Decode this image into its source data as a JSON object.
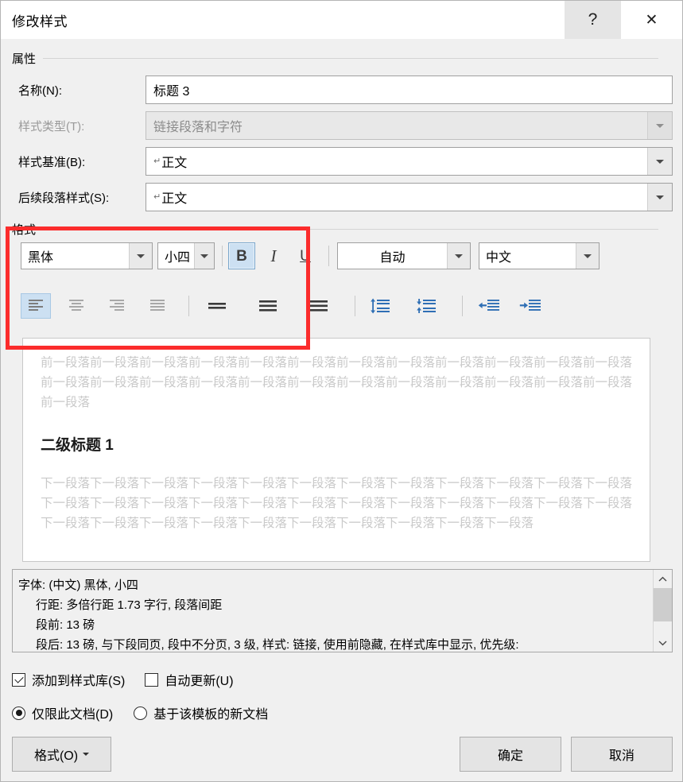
{
  "window": {
    "title": "修改样式",
    "help_label": "?",
    "close_label": "✕"
  },
  "properties": {
    "group_label": "属性",
    "fields": [
      {
        "label": "名称(N):",
        "label_plain": "名称(N):",
        "value": "标题 3",
        "type": "text",
        "disabled": false,
        "pilcrow": false
      },
      {
        "label": "样式类型(T):",
        "label_plain": "样式类型(T):",
        "value": "链接段落和字符",
        "type": "combo",
        "disabled": true,
        "pilcrow": false
      },
      {
        "label": "样式基准(B):",
        "label_plain": "样式基准(B):",
        "value": "正文",
        "type": "combo",
        "disabled": false,
        "pilcrow": true
      },
      {
        "label": "后续段落样式(S):",
        "label_plain": "后续段落样式(S):",
        "value": "正文",
        "type": "combo",
        "disabled": false,
        "pilcrow": true
      }
    ]
  },
  "format": {
    "group_label": "格式",
    "font_family": "黑体",
    "font_size": "小四",
    "font_color": "自动",
    "language": "中文",
    "bold_label": "B",
    "italic_label": "I",
    "underline_label": "U",
    "bold_active": true,
    "italic_active": false,
    "underline_active": false,
    "align_active": "left",
    "icons": {
      "align_left": "align-left-icon",
      "align_center": "align-center-icon",
      "align_right": "align-right-icon",
      "align_justify": "align-justify-icon",
      "line_spacing_single": "line-spacing-single-icon",
      "line_spacing_1_5": "line-spacing-1.5-icon",
      "line_spacing_double": "line-spacing-double-icon",
      "increase_spacing": "increase-paragraph-spacing-icon",
      "decrease_spacing": "decrease-paragraph-spacing-icon",
      "decrease_indent": "decrease-indent-icon",
      "increase_indent": "increase-indent-icon"
    }
  },
  "preview": {
    "before_paragraph_text": "前一段落前一段落前一段落前一段落前一段落前一段落前一段落前一段落前一段落前一段落前一段落前一段落前一段落前一段落前一段落前一段落前一段落前一段落前一段落前一段落前一段落前一段落前一段落前一段落前一段落",
    "heading_text": "二级标题 1",
    "after_paragraph_text": "下一段落下一段落下一段落下一段落下一段落下一段落下一段落下一段落下一段落下一段落下一段落下一段落下一段落下一段落下一段落下一段落下一段落下一段落下一段落下一段落下一段落下一段落下一段落下一段落下一段落下一段落下一段落下一段落下一段落下一段落下一段落下一段落下一段落下一段落"
  },
  "description": {
    "lines": [
      "字体: (中文) 黑体, 小四",
      "行距: 多倍行距 1.73 字行, 段落间距",
      "段前: 13 磅",
      "段后: 13 磅, 与下段同页, 段中不分页, 3 级, 样式: 链接, 使用前隐藏, 在样式库中显示, 优先级:"
    ],
    "scroll_up": "⌃",
    "scroll_down": "⌄"
  },
  "options": {
    "add_to_gallery": {
      "label": "添加到样式库(S)",
      "checked": true
    },
    "auto_update": {
      "label": "自动更新(U)",
      "checked": false
    },
    "only_this_doc": {
      "label": "仅限此文档(D)",
      "selected": true
    },
    "new_docs": {
      "label": "基于该模板的新文档",
      "selected": false
    }
  },
  "footer": {
    "format_button": "格式(O)",
    "ok_button": "确定",
    "cancel_button": "取消"
  },
  "colors": {
    "accent_red": "#fb2c2c",
    "selection_blue": "#cce0f2",
    "icon_blue": "#2f6fb5"
  }
}
